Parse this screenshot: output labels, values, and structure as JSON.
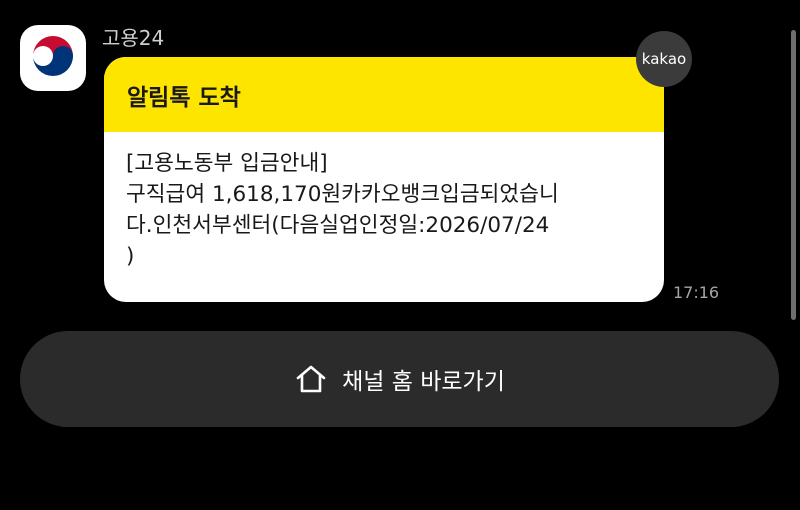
{
  "sender": {
    "name": "고용24",
    "avatar_icon": "korea-government-emblem-icon"
  },
  "message": {
    "header_title": "알림톡 도착",
    "header_color": "#FEE500",
    "lines": [
      "[고용노동부 입금안내]",
      "구직급여 1,618,170원카카오뱅크입금되었습니",
      "다.인천서부센터(다음실업인정일:2026/07/24",
      ")"
    ],
    "timestamp": "17:16",
    "badge": "kakao"
  },
  "channel_button": {
    "label": "채널 홈 바로가기",
    "icon": "home-icon"
  }
}
